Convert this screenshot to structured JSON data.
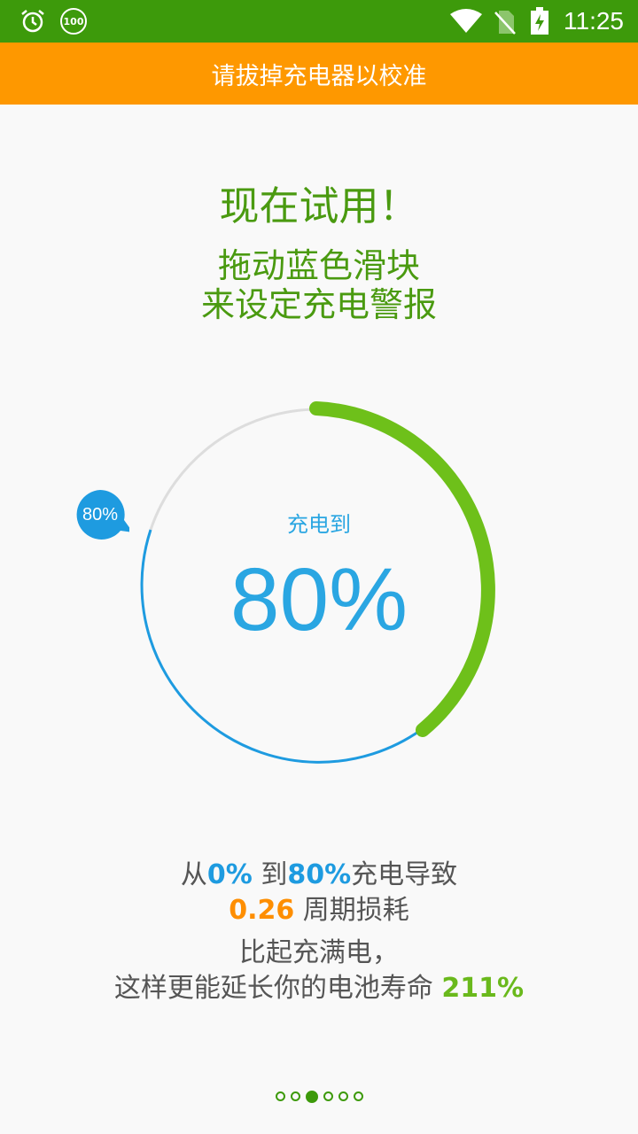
{
  "status_bar": {
    "time": "11:25",
    "icons": [
      "alarm-icon",
      "badge-100-icon",
      "wifi-icon",
      "no-sim-icon",
      "battery-charging-icon"
    ],
    "badge_text": "100"
  },
  "banner": {
    "text": "请拔掉充电器以校准"
  },
  "headline": "现在试用！",
  "instructions": {
    "line1": "拖动蓝色滑块",
    "line2": "来设定充电警报"
  },
  "gauge": {
    "label": "充电到",
    "value_text": "80%",
    "slider_text": "80%",
    "target_fraction": 0.8,
    "colors": {
      "blue": "#1e9be0",
      "green": "#6ec01a",
      "gray": "#dddddd"
    }
  },
  "info": {
    "l1_prefix": "从",
    "l1_from": "0%",
    "l1_to_word": " 到",
    "l1_to": "80%",
    "l1_suffix": "充电导致",
    "l2_value": "0.26",
    "l2_suffix": " 周期损耗",
    "l3": "比起充满电，",
    "l4_prefix": "这样更能延长你的电池寿命 ",
    "l4_value": "211%"
  },
  "pager": {
    "count": 6,
    "active_index": 2
  }
}
